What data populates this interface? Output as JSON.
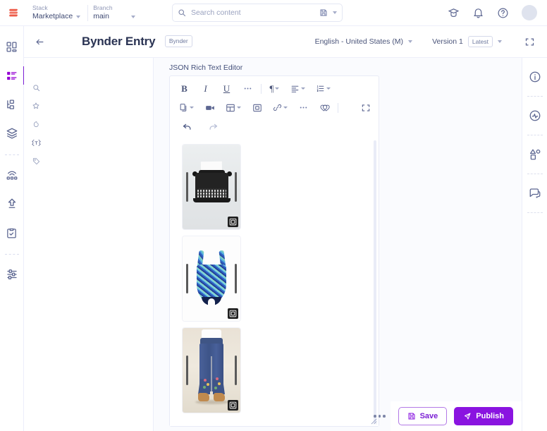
{
  "topbar": {
    "logo_icon": "contentstack-logo",
    "stack": {
      "label": "Stack",
      "value": "Marketplace"
    },
    "branch": {
      "label": "Branch",
      "value": "main"
    },
    "search": {
      "placeholder": "Search content",
      "value": "",
      "icon": "search-icon",
      "save_icon": "save-search-icon",
      "caret_icon": "chevron-down-icon"
    },
    "actions": [
      {
        "name": "academy",
        "icon": "graduation-cap-icon"
      },
      {
        "name": "notifications",
        "icon": "bell-icon"
      },
      {
        "name": "help",
        "icon": "help-circle-icon"
      },
      {
        "name": "account",
        "icon": "avatar"
      }
    ]
  },
  "left_rail": {
    "items": [
      {
        "name": "dashboard",
        "icon": "dashboard-grid-icon",
        "active": false
      },
      {
        "name": "content",
        "icon": "content-list-icon",
        "active": true
      },
      {
        "name": "taxonomy",
        "icon": "taxonomy-tree-icon",
        "active": false
      },
      {
        "name": "assets",
        "icon": "layers-stack-icon",
        "active": false
      },
      {
        "name": "live-preview",
        "icon": "broadcast-icon",
        "active": false
      },
      {
        "name": "releases",
        "icon": "upload-arrow-icon",
        "active": false
      },
      {
        "name": "audit",
        "icon": "clipboard-check-icon",
        "active": false
      },
      {
        "name": "settings",
        "icon": "sliders-icon",
        "active": false
      }
    ]
  },
  "panel_rail": {
    "items": [
      {
        "name": "search",
        "icon": "search-icon",
        "active": false
      },
      {
        "name": "favorites",
        "icon": "star-icon",
        "active": false
      },
      {
        "name": "entries",
        "icon": "entries-icon",
        "active": false
      },
      {
        "name": "content-types",
        "icon": "braces-t-icon",
        "active": true
      },
      {
        "name": "labels",
        "icon": "tag-icon",
        "active": false
      }
    ]
  },
  "entry_header": {
    "back_icon": "arrow-left-icon",
    "title": "Bynder Entry",
    "chip": "Bynder",
    "locale": {
      "value": "English - United States (M)",
      "caret_icon": "chevron-down-icon"
    },
    "version": {
      "label": "Version 1",
      "chip": "Latest",
      "caret_icon": "chevron-down-icon"
    },
    "expand_icon": "fullscreen-icon"
  },
  "editor": {
    "field_label": "JSON Rich Text Editor",
    "toolbar": {
      "row1": [
        {
          "name": "bold",
          "glyph": "B",
          "style": "bold",
          "dropdown": false
        },
        {
          "name": "italic",
          "glyph": "I",
          "style": "italic",
          "dropdown": false
        },
        {
          "name": "underline",
          "glyph": "U",
          "style": "underline",
          "dropdown": false
        },
        {
          "name": "more-marks",
          "icon": "ellipsis-icon",
          "dropdown": false
        },
        {
          "name": "paragraph-style",
          "icon": "paragraph-icon",
          "dropdown": true
        },
        {
          "name": "text-align",
          "icon": "align-left-icon",
          "dropdown": true
        },
        {
          "name": "list",
          "icon": "ordered-list-icon",
          "dropdown": true
        }
      ],
      "row2": [
        {
          "name": "insert-block",
          "icon": "copy-icon",
          "dropdown": true
        },
        {
          "name": "video",
          "icon": "video-camera-icon",
          "dropdown": false
        },
        {
          "name": "table",
          "icon": "table-icon",
          "dropdown": true
        },
        {
          "name": "embed-entry",
          "icon": "embed-square-icon",
          "dropdown": false
        },
        {
          "name": "link",
          "icon": "link-slash-icon",
          "dropdown": true
        },
        {
          "name": "more-tools",
          "icon": "ellipsis-icon",
          "dropdown": false
        },
        {
          "name": "bynder",
          "icon": "bynder-heart-icon",
          "dropdown": false
        },
        {
          "name": "fullscreen",
          "icon": "fullscreen-icon",
          "dropdown": false
        }
      ],
      "row3": [
        {
          "name": "undo",
          "icon": "undo-arrow-icon",
          "disabled": false
        },
        {
          "name": "redo",
          "icon": "redo-arrow-icon",
          "disabled": true
        }
      ]
    },
    "assets": [
      {
        "name": "typewriter-asset",
        "alt": "Vintage black typewriter with a sheet of paper",
        "badge_icon": "asset-embed-icon"
      },
      {
        "name": "swimsuit-asset",
        "alt": "Blue floral patterned one-piece swimsuit",
        "badge_icon": "asset-embed-icon"
      },
      {
        "name": "jeans-asset",
        "alt": "Embroidered flared blue jeans with tan sandals",
        "badge_icon": "asset-embed-icon"
      }
    ],
    "scrollbar": "vertical-scrollbar",
    "resize_grip": "resize-grip"
  },
  "right_rail": {
    "items": [
      {
        "name": "details",
        "icon": "info-circle-icon"
      },
      {
        "name": "activity",
        "icon": "pulse-circle-icon"
      },
      {
        "name": "variants",
        "icon": "shapes-icon"
      },
      {
        "name": "comments",
        "icon": "chat-bubbles-icon"
      }
    ]
  },
  "footer": {
    "more_icon": "kebab-menu-icon",
    "save": {
      "label": "Save",
      "icon": "floppy-disk-icon"
    },
    "publish": {
      "label": "Publish",
      "icon": "rocket-icon"
    }
  },
  "colors": {
    "accent_purple": "#8a14e0",
    "accent_purple_light": "#b37ae6",
    "text_primary": "#2a3353",
    "text_secondary": "#475073",
    "muted": "#9aa2bf",
    "canvas": "#fafbfe",
    "border": "#e8ebf6"
  }
}
